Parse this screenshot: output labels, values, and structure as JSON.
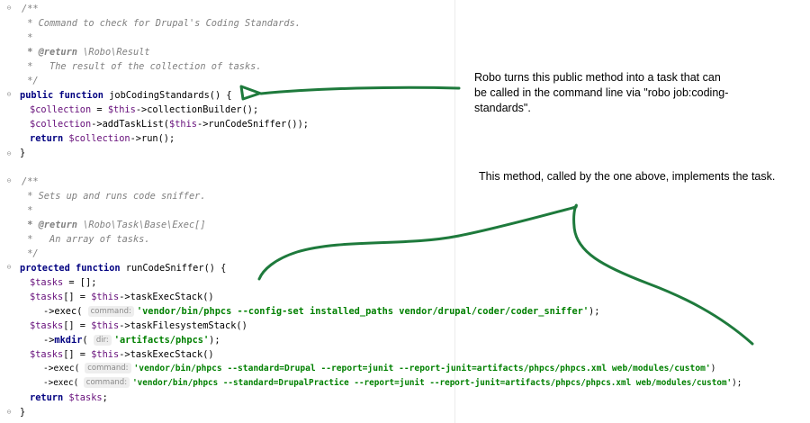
{
  "code": {
    "l1": "/**",
    "l2": " * Command to check for Drupal's Coding Standards.",
    "l3": " *",
    "l4_tag": " * @return",
    "l4_rest": " \\Robo\\Result",
    "l5": " *   The result of the collection of tasks.",
    "l6": " */",
    "l7_kw": "public function",
    "l7_fn": " jobCodingStandards() {",
    "l8_v": "$collection",
    "l8_a": " = ",
    "l8_this": "$this",
    "l8_b": "->collectionBuilder();",
    "l9_v": "$collection",
    "l9_a": "->addTaskList(",
    "l9_this": "$this",
    "l9_b": "->runCodeSniffer());",
    "l10_kw": "return",
    "l10_v": " $collection",
    "l10_b": "->run();",
    "l11": "}",
    "l13": "/**",
    "l14": " * Sets up and runs code sniffer.",
    "l15": " *",
    "l16_tag": " * @return",
    "l16_rest": " \\Robo\\Task\\Base\\Exec[]",
    "l17": " *   An array of tasks.",
    "l18": " */",
    "l19_kw": "protected function",
    "l19_fn": " runCodeSniffer() {",
    "l20_v": "$tasks",
    "l20_a": " = [];",
    "l21_v": "$tasks",
    "l21_a": "[] = ",
    "l21_this": "$this",
    "l21_b": "->taskExecStack()",
    "l22_a": "->exec( ",
    "l22_hint": "command:",
    "l22_s": "'vendor/bin/phpcs --config-set installed_paths vendor/drupal/coder/coder_sniffer'",
    "l22_b": ");",
    "l23_v": "$tasks",
    "l23_a": "[] = ",
    "l23_this": "$this",
    "l23_b": "->taskFilesystemStack()",
    "l24_a": "->",
    "l24_fn": "mkdir",
    "l24_b": "( ",
    "l24_hint": "dir:",
    "l24_s": "'artifacts/phpcs'",
    "l24_c": ");",
    "l25_v": "$tasks",
    "l25_a": "[] = ",
    "l25_this": "$this",
    "l25_b": "->taskExecStack()",
    "l26_a": "->exec( ",
    "l26_hint": "command:",
    "l26_s": "'vendor/bin/phpcs --standard=Drupal --report=junit --report-junit=artifacts/phpcs/phpcs.xml web/modules/custom'",
    "l26_b": ")",
    "l27_a": "->exec( ",
    "l27_hint": "command:",
    "l27_s": "'vendor/bin/phpcs --standard=DrupalPractice --report=junit --report-junit=artifacts/phpcs/phpcs.xml web/modules/custom'",
    "l27_b": ");",
    "l28_kw": "return",
    "l28_v": " $tasks",
    "l28_b": ";",
    "l29": "}"
  },
  "annotations": {
    "first": "Robo turns this public method into a task that can be called in the command line via \"robo job:coding-standards\".",
    "second": "This method, called by the one above, implements the task."
  },
  "colors": {
    "arrow": "#1e7a3c",
    "keyword": "#000080",
    "variable": "#660e7a",
    "string": "#008000",
    "comment": "#808080"
  }
}
